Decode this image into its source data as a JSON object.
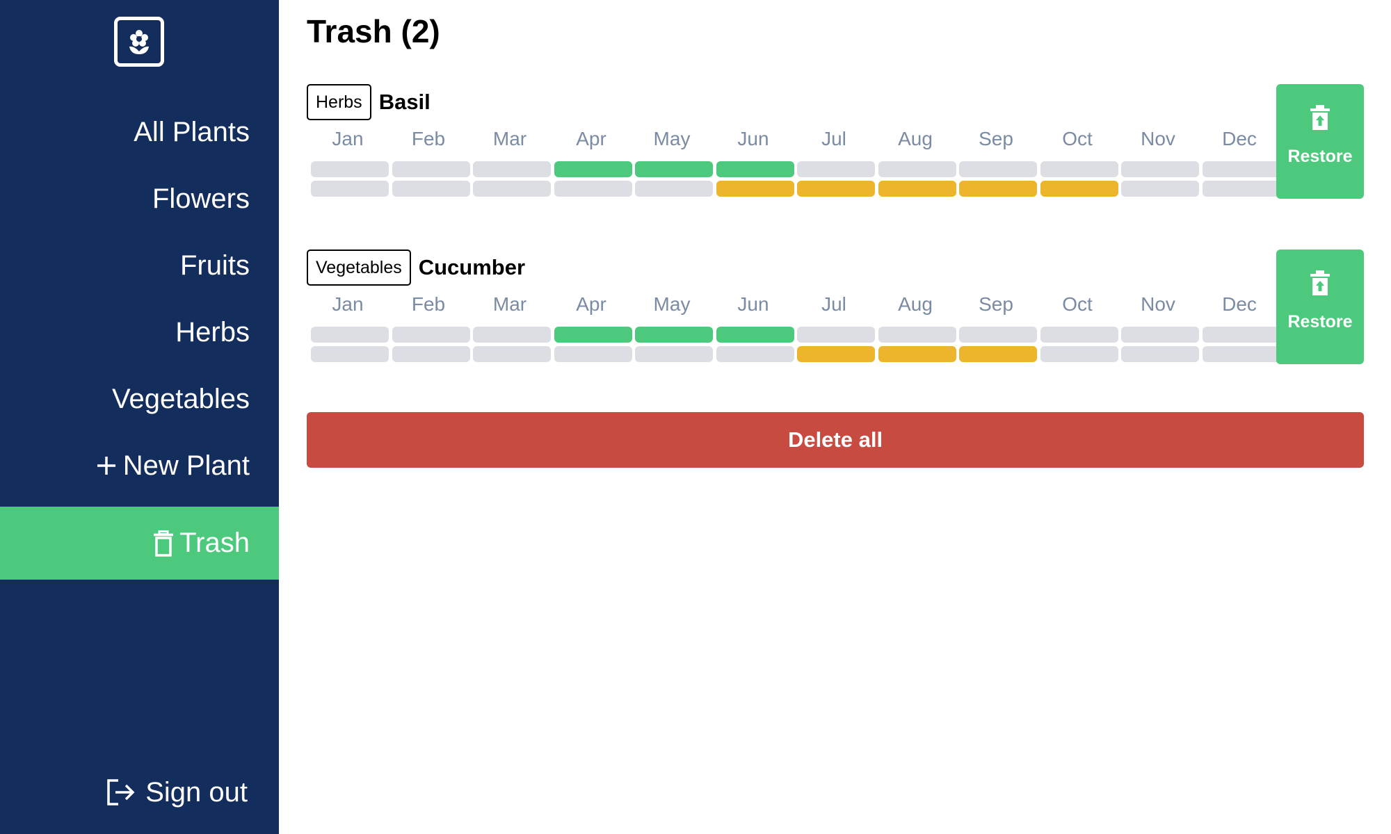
{
  "app": {
    "logo_icon": "flower-logo-icon"
  },
  "sidebar": {
    "items": [
      {
        "label": "All Plants",
        "name": "sidebar-item-all-plants"
      },
      {
        "label": "Flowers",
        "name": "sidebar-item-flowers"
      },
      {
        "label": "Fruits",
        "name": "sidebar-item-fruits"
      },
      {
        "label": "Herbs",
        "name": "sidebar-item-herbs"
      },
      {
        "label": "Vegetables",
        "name": "sidebar-item-vegetables"
      },
      {
        "label": "New Plant",
        "name": "sidebar-item-new-plant",
        "icon": "plus-icon"
      },
      {
        "label": "Trash",
        "name": "sidebar-item-trash",
        "icon": "trash-icon",
        "active": true
      }
    ],
    "signout": {
      "label": "Sign out",
      "icon": "sign-out-icon"
    }
  },
  "main": {
    "title": "Trash (2)",
    "months": [
      "Jan",
      "Feb",
      "Mar",
      "Apr",
      "May",
      "Jun",
      "Jul",
      "Aug",
      "Sep",
      "Oct",
      "Nov",
      "Dec"
    ],
    "plants": [
      {
        "category": "Herbs",
        "name": "Basil",
        "sow_months": [
          3,
          4,
          5
        ],
        "harvest_months": [
          5,
          6,
          7,
          8,
          9
        ],
        "restore_label": "Restore",
        "restore_icon": "restore-trash-icon"
      },
      {
        "category": "Vegetables",
        "name": "Cucumber",
        "sow_months": [
          3,
          4,
          5
        ],
        "harvest_months": [
          6,
          7,
          8
        ],
        "restore_label": "Restore",
        "restore_icon": "restore-trash-icon"
      }
    ],
    "delete_all_label": "Delete all"
  },
  "colors": {
    "sidebar_bg": "#132d5c",
    "accent_green": "#4cc97c",
    "sow_green": "#4cc97c",
    "harvest_yellow": "#ecb52b",
    "empty_cell": "#dcdee4",
    "month_label": "#7a8ba3",
    "danger_red": "#c84b42"
  }
}
